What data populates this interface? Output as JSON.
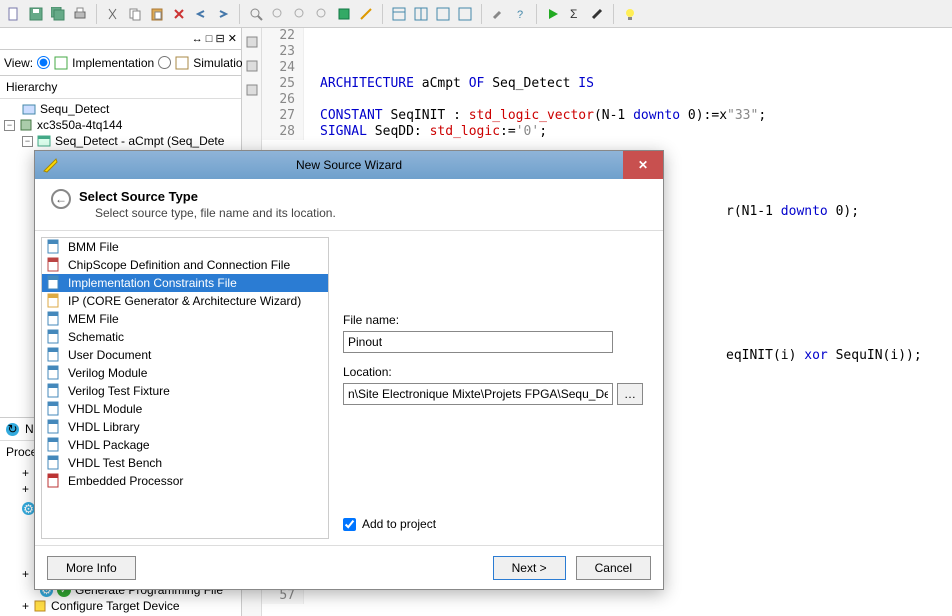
{
  "view": {
    "label": "View:",
    "impl": "Implementation",
    "sim": "Simulation"
  },
  "hierarchy": {
    "label": "Hierarchy",
    "items": [
      {
        "label": "Sequ_Detect",
        "indent": 0,
        "exp": ""
      },
      {
        "label": "xc3s50a-4tq144",
        "indent": 0,
        "exp": "-"
      },
      {
        "label": "Seq_Detect - aCmpt (Seq_Dete",
        "indent": 1,
        "exp": "-"
      }
    ]
  },
  "processes": {
    "label": "Proces",
    "nolabel": "No",
    "items": [
      {
        "label": "Generate Programming File",
        "ok": true
      },
      {
        "label": "Configure Target Device",
        "ok": false
      }
    ]
  },
  "code": {
    "lines": [
      {
        "n": "22",
        "t": ""
      },
      {
        "n": "23",
        "t": ""
      },
      {
        "n": "24",
        "t": ""
      },
      {
        "n": "25",
        "t": "ARCHITECTURE aCmpt OF Seq_Detect IS",
        "kw": [
          "ARCHITECTURE",
          "OF",
          "IS"
        ]
      },
      {
        "n": "26",
        "t": ""
      },
      {
        "n": "27",
        "t": "CONSTANT SeqINIT : std_logic_vector(N-1 downto 0):=x\"33\";",
        "kw": [
          "CONSTANT",
          "downto"
        ],
        "ty": [
          "std_logic_vector"
        ],
        "str": [
          "\"33\""
        ]
      },
      {
        "n": "28",
        "t": "SIGNAL SeqDD: std_logic:='0';",
        "kw": [
          "SIGNAL"
        ],
        "ty": [
          "std_logic"
        ],
        "str": [
          "'0'"
        ]
      }
    ],
    "frags": [
      {
        "n": "",
        "t": "r(N1-1 downto 0);",
        "kw": [
          "downto"
        ]
      },
      {
        "n": "",
        "t": "eqINIT(i) xor SequIN(i));",
        "kw": [
          "xor"
        ]
      }
    ],
    "lastline": "57"
  },
  "dialog": {
    "title": "New Source Wizard",
    "step_title": "Select Source Type",
    "step_sub": "Select source type, file name and its location.",
    "source_types": [
      "BMM File",
      "ChipScope Definition and Connection File",
      "Implementation Constraints File",
      "IP (CORE Generator & Architecture Wizard)",
      "MEM File",
      "Schematic",
      "User Document",
      "Verilog Module",
      "Verilog Test Fixture",
      "VHDL Module",
      "VHDL Library",
      "VHDL Package",
      "VHDL Test Bench",
      "Embedded Processor"
    ],
    "selected_index": 2,
    "filename_label": "File name:",
    "filename_value": "Pinout",
    "location_label": "Location:",
    "location_value": "n\\Site Electronique Mixte\\Projets FPGA\\Sequ_Detect",
    "add_label": "Add to project",
    "add_checked": true,
    "more": "More Info",
    "next": "Next >",
    "cancel": "Cancel"
  }
}
